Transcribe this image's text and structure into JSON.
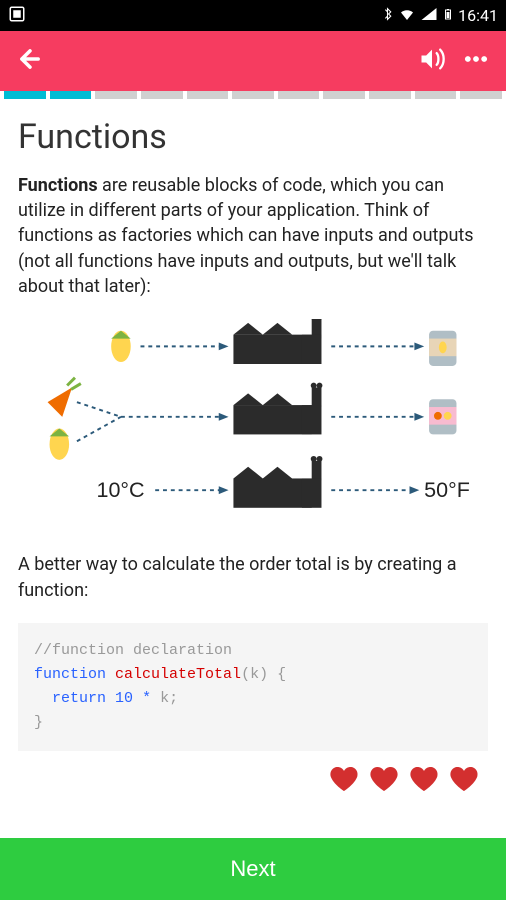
{
  "status": {
    "time": "16:41"
  },
  "progress": {
    "segments": 11,
    "active": [
      0,
      1
    ]
  },
  "content": {
    "title": "Functions",
    "intro_bold": "Functions",
    "intro_rest": " are reusable blocks of code, which you can utilize in different parts of your application. Think of functions as factories which can have inputs and outputs (not all functions have inputs and outputs, but we'll talk about that later):",
    "diagram": {
      "input_temp": "10°C",
      "output_temp": "50°F"
    },
    "second_text": "A better way to calculate the order total is by creating a function:",
    "code": {
      "comment": "//function declaration",
      "keyword": "function",
      "fname": "calculateTotal",
      "param": "k",
      "ret": "return",
      "expr_num": "10",
      "expr_op": "*",
      "expr_var": "k"
    }
  },
  "hearts_count": 4,
  "next_label": "Next"
}
